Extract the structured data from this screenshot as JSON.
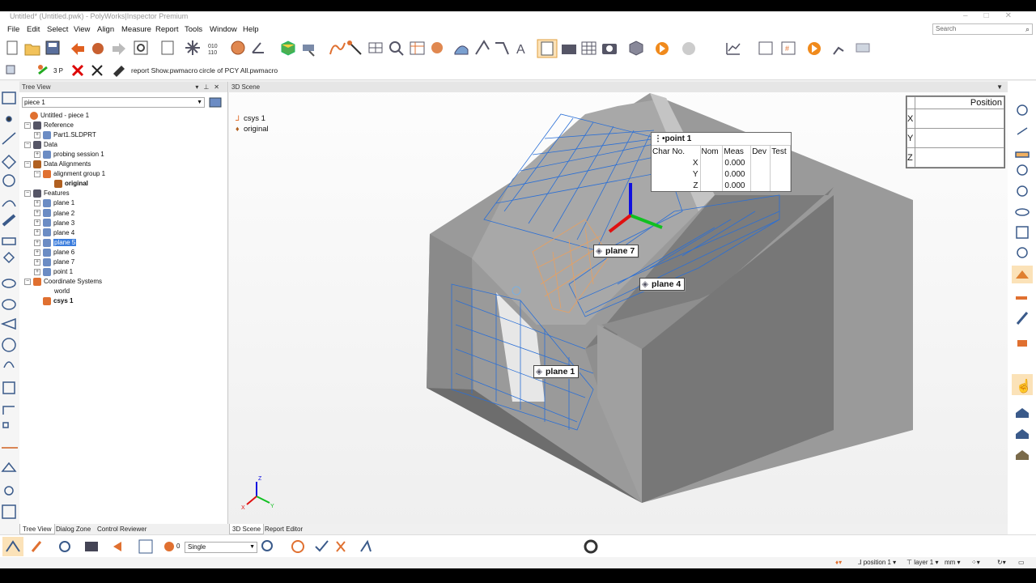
{
  "window": {
    "title": "Untitled* (Untitled.pwk) - PolyWorks|Inspector Premium"
  },
  "menu": [
    "File",
    "Edit",
    "Select",
    "View",
    "Align",
    "Measure",
    "Report",
    "Tools",
    "Window",
    "Help"
  ],
  "search": {
    "placeholder": "Search"
  },
  "toolbar2": {
    "probe_label": "3 P",
    "macros": [
      "report Show.pwmacro",
      "circle of PCY All.pwmacro"
    ]
  },
  "tree_panel": {
    "header": "Tree View",
    "piece": "piece 1",
    "nodes": [
      {
        "label": "Untitled - piece 1"
      },
      {
        "label": "Reference"
      },
      {
        "label": "Part1.SLDPRT"
      },
      {
        "label": "Data"
      },
      {
        "label": "probing session 1"
      },
      {
        "label": "Data Alignments"
      },
      {
        "label": "alignment group 1"
      },
      {
        "label": "original"
      },
      {
        "label": "Features"
      },
      {
        "label": "plane 1"
      },
      {
        "label": "plane 2"
      },
      {
        "label": "plane 3"
      },
      {
        "label": "plane 4"
      },
      {
        "label": "plane 5"
      },
      {
        "label": "plane 6"
      },
      {
        "label": "plane 7"
      },
      {
        "label": "point 1"
      },
      {
        "label": "Coordinate Systems"
      },
      {
        "label": "world"
      },
      {
        "label": "csys 1"
      }
    ],
    "tabs": [
      "Tree View",
      "Dialog Zone",
      "Control Reviewer"
    ]
  },
  "scene": {
    "header": "3D Scene",
    "scene_tree": [
      "csys 1",
      "original"
    ],
    "callouts": {
      "plane7": "plane 7",
      "plane4": "plane 4",
      "plane1": "plane 1"
    },
    "point_table": {
      "title": "point 1",
      "headers": [
        "Char No.",
        "Nom",
        "Meas",
        "Dev",
        "Test"
      ],
      "rows": [
        {
          "axis": "X",
          "meas": "0.000"
        },
        {
          "axis": "Y",
          "meas": "0.000"
        },
        {
          "axis": "Z",
          "meas": "0.000"
        }
      ]
    },
    "position_table": {
      "header": "Position",
      "rows": [
        "X",
        "Y",
        "Z"
      ]
    },
    "triad": {
      "x": "X",
      "y": "Y",
      "z": "Z"
    },
    "colors": {
      "mesh_blue": "#2a6fd6",
      "mesh_orange": "#e8a060",
      "part_gray": "#8a8a8a"
    }
  },
  "bottom_tabs": [
    "3D Scene",
    "Report Editor"
  ],
  "bottom_toolbar": {
    "counter": "0",
    "mode": "Single"
  },
  "status": {
    "position": "position 1",
    "layer": "layer 1",
    "units": "mm"
  }
}
